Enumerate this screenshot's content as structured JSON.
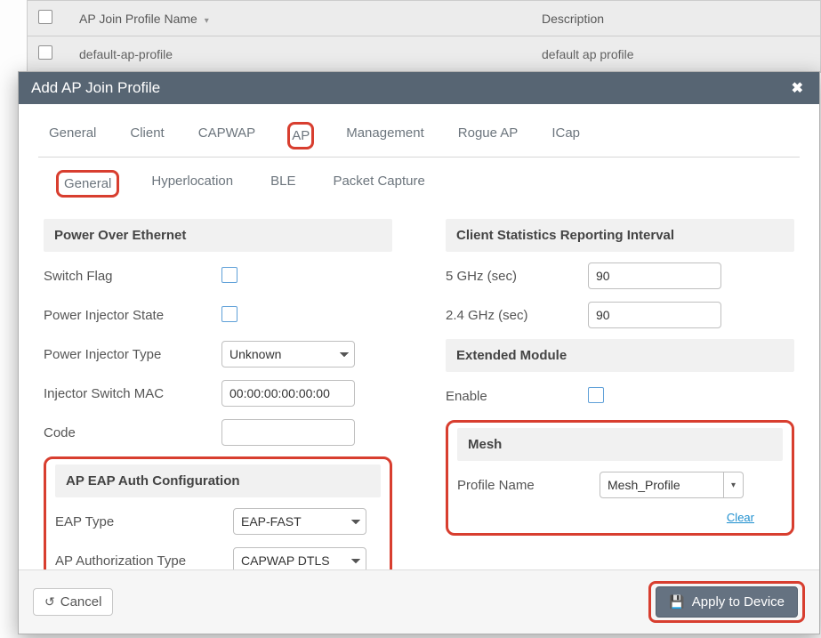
{
  "bg_table": {
    "headers": {
      "name": "AP Join Profile Name",
      "desc": "Description"
    },
    "rows": [
      {
        "name": "default-ap-profile",
        "desc": "default ap profile"
      }
    ]
  },
  "modal": {
    "title": "Add AP Join Profile",
    "tabs_primary": [
      "General",
      "Client",
      "CAPWAP",
      "AP",
      "Management",
      "Rogue AP",
      "ICap"
    ],
    "tabs_primary_active_index": 3,
    "tabs_secondary": [
      "General",
      "Hyperlocation",
      "BLE",
      "Packet Capture"
    ],
    "tabs_secondary_active_index": 0,
    "left": {
      "poe": {
        "title": "Power Over Ethernet",
        "switch_flag_label": "Switch Flag",
        "switch_flag": false,
        "injector_state_label": "Power Injector State",
        "injector_state": false,
        "injector_type_label": "Power Injector Type",
        "injector_type_value": "Unknown",
        "injector_mac_label": "Injector Switch MAC",
        "injector_mac_value": "00:00:00:00:00:00",
        "code_label": "Code",
        "code_value": ""
      },
      "eap": {
        "title": "AP EAP Auth Configuration",
        "eap_type_label": "EAP Type",
        "eap_type_value": "EAP-FAST",
        "auth_type_label": "AP Authorization Type",
        "auth_type_value": "CAPWAP DTLS"
      }
    },
    "right": {
      "stats": {
        "title": "Client Statistics Reporting Interval",
        "five_label": "5 GHz (sec)",
        "five_value": "90",
        "two_label": "2.4 GHz (sec)",
        "two_value": "90"
      },
      "ext": {
        "title": "Extended Module",
        "enable_label": "Enable",
        "enable": false
      },
      "mesh": {
        "title": "Mesh",
        "profile_label": "Profile Name",
        "profile_value": "Mesh_Profile",
        "clear_label": "Clear"
      }
    },
    "footer": {
      "cancel_label": "Cancel",
      "apply_label": "Apply to Device"
    }
  }
}
